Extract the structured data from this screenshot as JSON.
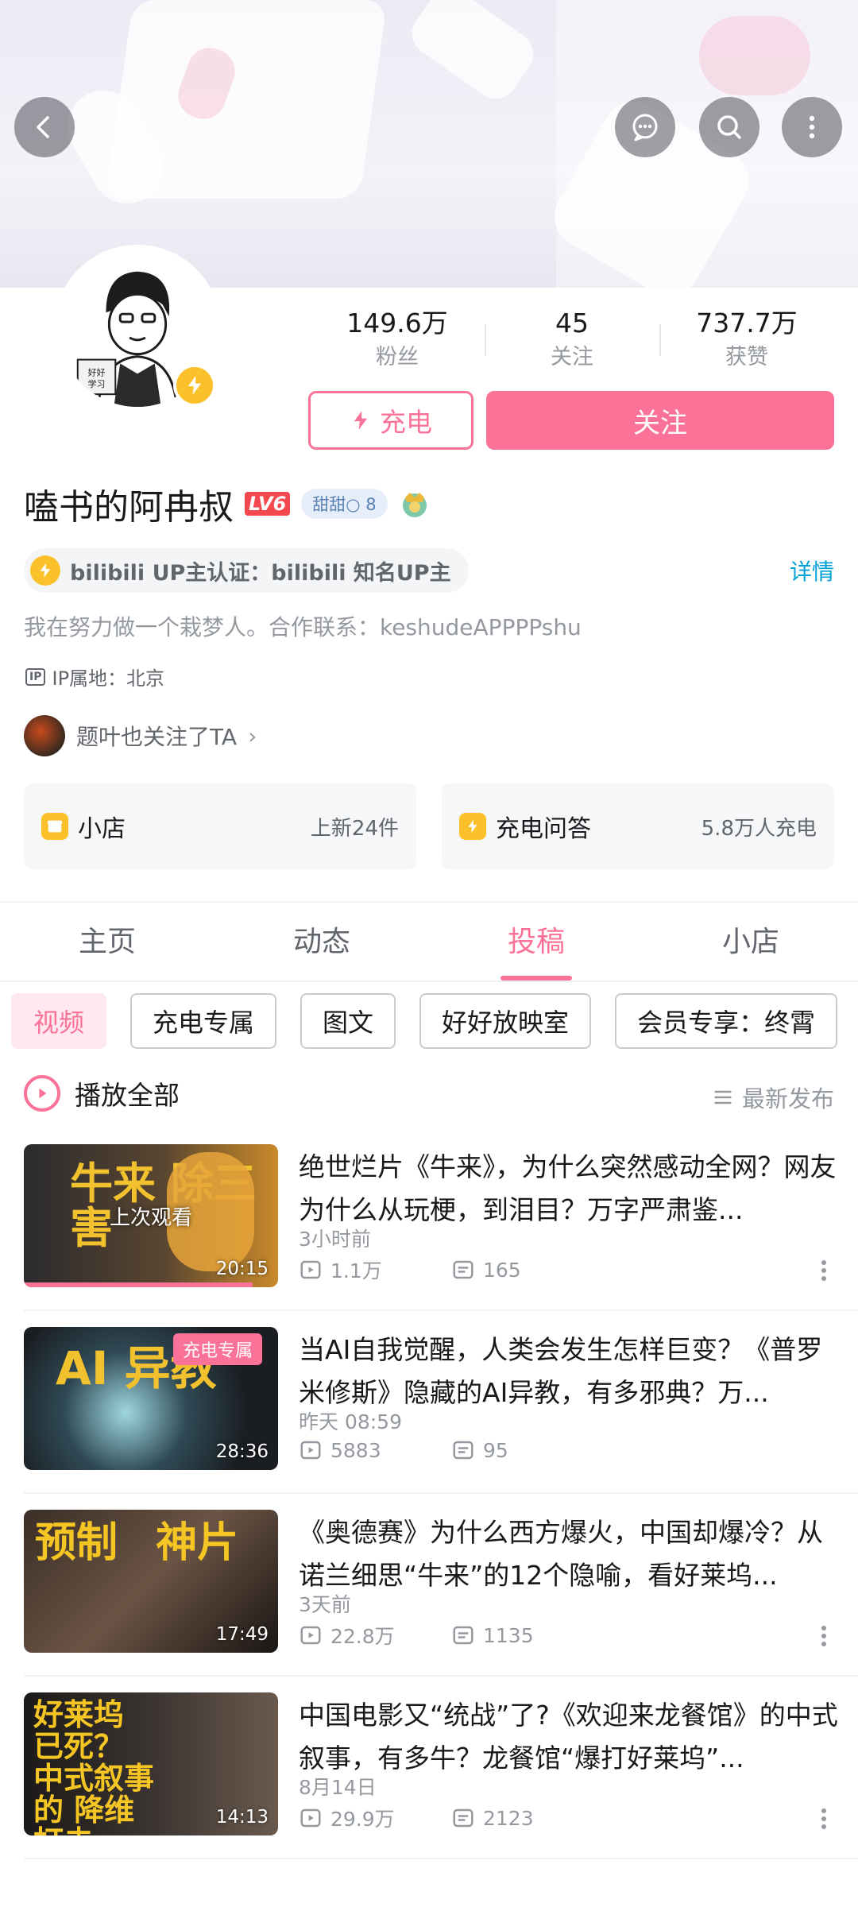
{
  "header": {
    "back_icon": "back-arrow-icon",
    "message_icon": "message-icon",
    "search_icon": "search-icon",
    "more_icon": "more-vertical-icon"
  },
  "profile": {
    "name": "嗑书的阿冉叔",
    "level": "LV6",
    "fan_medal": "甜甜○ 8",
    "stats": [
      {
        "value": "149.6万",
        "label": "粉丝"
      },
      {
        "value": "45",
        "label": "关注"
      },
      {
        "value": "737.7万",
        "label": "获赞"
      }
    ],
    "charge_label": "充电",
    "follow_label": "关注",
    "verification": "bilibili UP主认证：bilibili 知名UP主",
    "details_link": "详情",
    "bio": "我在努力做一个栽梦人。合作联系：keshudeAPPPPshu",
    "ip_badge": "IP",
    "ip_location": "IP属地：北京",
    "mutual_follow": "题叶也关注了TA",
    "mutual_chevron": "›",
    "avatar_text": "好好学习"
  },
  "cards": [
    {
      "title": "小店",
      "subtitle": "上新24件"
    },
    {
      "title": "充电问答",
      "subtitle": "5.8万人充电"
    }
  ],
  "tabs": [
    "主页",
    "动态",
    "投稿",
    "小店"
  ],
  "active_tab": "投稿",
  "filters": [
    "视频",
    "充电专属",
    "图文",
    "好好放映室",
    "会员专享：终霄"
  ],
  "play_all": "播放全部",
  "sort": "最新发布",
  "videos": [
    {
      "title": "绝世烂片《牛来》，为什么突然感动全网？网友为什么从玩梗，到泪目？万字严肃鉴...",
      "time": "3小时前",
      "views": "1.1万",
      "danmaku": "165",
      "duration": "20:15",
      "overlay": "上次观看",
      "thumb_text": "牛来 除三害",
      "watch_progress": 0.9
    },
    {
      "title": "当AI自我觉醒，人类会发生怎样巨变？《普罗米修斯》隐藏的AI异教，有多邪典？万...",
      "time": "昨天 08:59",
      "views": "5883",
      "danmaku": "95",
      "duration": "28:36",
      "tag": "充电专属",
      "thumb_text": "AI 异教"
    },
    {
      "title": "《奥德赛》为什么西方爆火，中国却爆冷？从诺兰细思“牛来”的12个隐喻，看好莱坞...",
      "time": "3天前",
      "views": "22.8万",
      "danmaku": "1135",
      "duration": "17:49",
      "thumb_text": "预制 神片"
    },
    {
      "title": "中国电影又“统战”了?《欢迎来龙餐馆》的中式叙事，有多牛？龙餐馆“爆打好莱坞”...",
      "time": "8月14日",
      "views": "29.9万",
      "danmaku": "2123",
      "duration": "14:13",
      "thumb_text": "好莱坞 已死？ 中式叙事的 降维打击"
    }
  ]
}
